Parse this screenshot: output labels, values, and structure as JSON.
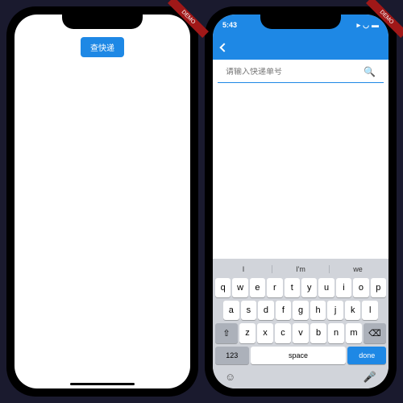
{
  "ribbon": "DEMO",
  "left": {
    "button": "查快递"
  },
  "right": {
    "time": "5:43",
    "placeholder": "请输入快递单号",
    "suggestions": [
      "I",
      "I'm",
      "we"
    ],
    "rows": {
      "r1": [
        "q",
        "w",
        "e",
        "r",
        "t",
        "y",
        "u",
        "i",
        "o",
        "p"
      ],
      "r2": [
        "a",
        "s",
        "d",
        "f",
        "g",
        "h",
        "j",
        "k",
        "l"
      ],
      "r3": [
        "z",
        "x",
        "c",
        "v",
        "b",
        "n",
        "m"
      ]
    },
    "shift": "⇧",
    "del": "⌫",
    "numkey": "123",
    "space": "space",
    "done": "done",
    "emoji": "☺",
    "mic": "🎤"
  }
}
